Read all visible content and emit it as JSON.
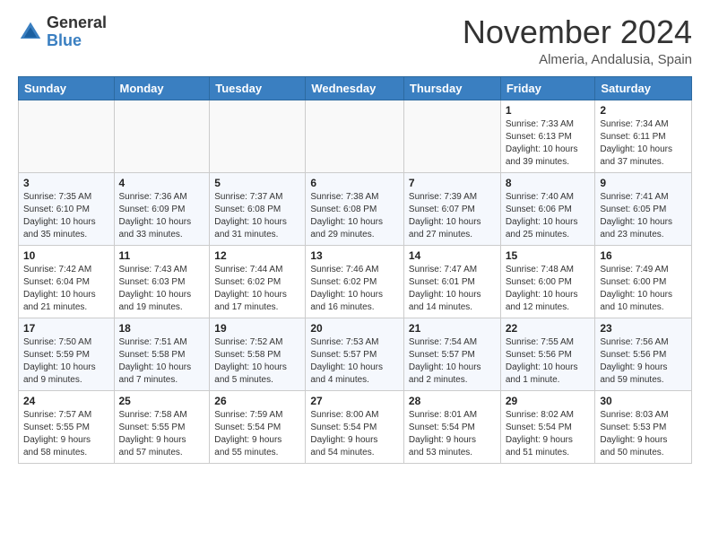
{
  "header": {
    "logo_general": "General",
    "logo_blue": "Blue",
    "month": "November 2024",
    "location": "Almeria, Andalusia, Spain"
  },
  "weekdays": [
    "Sunday",
    "Monday",
    "Tuesday",
    "Wednesday",
    "Thursday",
    "Friday",
    "Saturday"
  ],
  "weeks": [
    [
      {
        "day": "",
        "info": ""
      },
      {
        "day": "",
        "info": ""
      },
      {
        "day": "",
        "info": ""
      },
      {
        "day": "",
        "info": ""
      },
      {
        "day": "",
        "info": ""
      },
      {
        "day": "1",
        "info": "Sunrise: 7:33 AM\nSunset: 6:13 PM\nDaylight: 10 hours\nand 39 minutes."
      },
      {
        "day": "2",
        "info": "Sunrise: 7:34 AM\nSunset: 6:11 PM\nDaylight: 10 hours\nand 37 minutes."
      }
    ],
    [
      {
        "day": "3",
        "info": "Sunrise: 7:35 AM\nSunset: 6:10 PM\nDaylight: 10 hours\nand 35 minutes."
      },
      {
        "day": "4",
        "info": "Sunrise: 7:36 AM\nSunset: 6:09 PM\nDaylight: 10 hours\nand 33 minutes."
      },
      {
        "day": "5",
        "info": "Sunrise: 7:37 AM\nSunset: 6:08 PM\nDaylight: 10 hours\nand 31 minutes."
      },
      {
        "day": "6",
        "info": "Sunrise: 7:38 AM\nSunset: 6:08 PM\nDaylight: 10 hours\nand 29 minutes."
      },
      {
        "day": "7",
        "info": "Sunrise: 7:39 AM\nSunset: 6:07 PM\nDaylight: 10 hours\nand 27 minutes."
      },
      {
        "day": "8",
        "info": "Sunrise: 7:40 AM\nSunset: 6:06 PM\nDaylight: 10 hours\nand 25 minutes."
      },
      {
        "day": "9",
        "info": "Sunrise: 7:41 AM\nSunset: 6:05 PM\nDaylight: 10 hours\nand 23 minutes."
      }
    ],
    [
      {
        "day": "10",
        "info": "Sunrise: 7:42 AM\nSunset: 6:04 PM\nDaylight: 10 hours\nand 21 minutes."
      },
      {
        "day": "11",
        "info": "Sunrise: 7:43 AM\nSunset: 6:03 PM\nDaylight: 10 hours\nand 19 minutes."
      },
      {
        "day": "12",
        "info": "Sunrise: 7:44 AM\nSunset: 6:02 PM\nDaylight: 10 hours\nand 17 minutes."
      },
      {
        "day": "13",
        "info": "Sunrise: 7:46 AM\nSunset: 6:02 PM\nDaylight: 10 hours\nand 16 minutes."
      },
      {
        "day": "14",
        "info": "Sunrise: 7:47 AM\nSunset: 6:01 PM\nDaylight: 10 hours\nand 14 minutes."
      },
      {
        "day": "15",
        "info": "Sunrise: 7:48 AM\nSunset: 6:00 PM\nDaylight: 10 hours\nand 12 minutes."
      },
      {
        "day": "16",
        "info": "Sunrise: 7:49 AM\nSunset: 6:00 PM\nDaylight: 10 hours\nand 10 minutes."
      }
    ],
    [
      {
        "day": "17",
        "info": "Sunrise: 7:50 AM\nSunset: 5:59 PM\nDaylight: 10 hours\nand 9 minutes."
      },
      {
        "day": "18",
        "info": "Sunrise: 7:51 AM\nSunset: 5:58 PM\nDaylight: 10 hours\nand 7 minutes."
      },
      {
        "day": "19",
        "info": "Sunrise: 7:52 AM\nSunset: 5:58 PM\nDaylight: 10 hours\nand 5 minutes."
      },
      {
        "day": "20",
        "info": "Sunrise: 7:53 AM\nSunset: 5:57 PM\nDaylight: 10 hours\nand 4 minutes."
      },
      {
        "day": "21",
        "info": "Sunrise: 7:54 AM\nSunset: 5:57 PM\nDaylight: 10 hours\nand 2 minutes."
      },
      {
        "day": "22",
        "info": "Sunrise: 7:55 AM\nSunset: 5:56 PM\nDaylight: 10 hours\nand 1 minute."
      },
      {
        "day": "23",
        "info": "Sunrise: 7:56 AM\nSunset: 5:56 PM\nDaylight: 9 hours\nand 59 minutes."
      }
    ],
    [
      {
        "day": "24",
        "info": "Sunrise: 7:57 AM\nSunset: 5:55 PM\nDaylight: 9 hours\nand 58 minutes."
      },
      {
        "day": "25",
        "info": "Sunrise: 7:58 AM\nSunset: 5:55 PM\nDaylight: 9 hours\nand 57 minutes."
      },
      {
        "day": "26",
        "info": "Sunrise: 7:59 AM\nSunset: 5:54 PM\nDaylight: 9 hours\nand 55 minutes."
      },
      {
        "day": "27",
        "info": "Sunrise: 8:00 AM\nSunset: 5:54 PM\nDaylight: 9 hours\nand 54 minutes."
      },
      {
        "day": "28",
        "info": "Sunrise: 8:01 AM\nSunset: 5:54 PM\nDaylight: 9 hours\nand 53 minutes."
      },
      {
        "day": "29",
        "info": "Sunrise: 8:02 AM\nSunset: 5:54 PM\nDaylight: 9 hours\nand 51 minutes."
      },
      {
        "day": "30",
        "info": "Sunrise: 8:03 AM\nSunset: 5:53 PM\nDaylight: 9 hours\nand 50 minutes."
      }
    ]
  ]
}
